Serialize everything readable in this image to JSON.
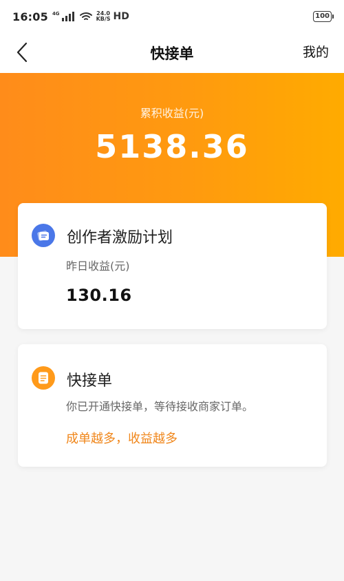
{
  "status_bar": {
    "time": "16:05",
    "network": "4G",
    "speed_value": "24.0",
    "speed_unit": "KB/S",
    "hd": "HD",
    "battery": "100"
  },
  "nav": {
    "title": "快接单",
    "right_label": "我的"
  },
  "hero": {
    "label": "累积收益(元)",
    "value": "5138.36"
  },
  "cards": [
    {
      "title": "创作者激励计划",
      "subtitle": "昨日收益(元)",
      "amount": "130.16",
      "icon": "ticket-icon"
    },
    {
      "title": "快接单",
      "subtitle": "你已开通快接单，等待接收商家订单。",
      "cta": "成单越多，收益越多",
      "icon": "document-icon"
    }
  ],
  "colors": {
    "accent_orange": "#ff9a1a",
    "hero_gradient_start": "#ff8c1a",
    "hero_gradient_end": "#ffab00",
    "blue_icon": "#4a77e8",
    "cta_text": "#f0861a"
  }
}
